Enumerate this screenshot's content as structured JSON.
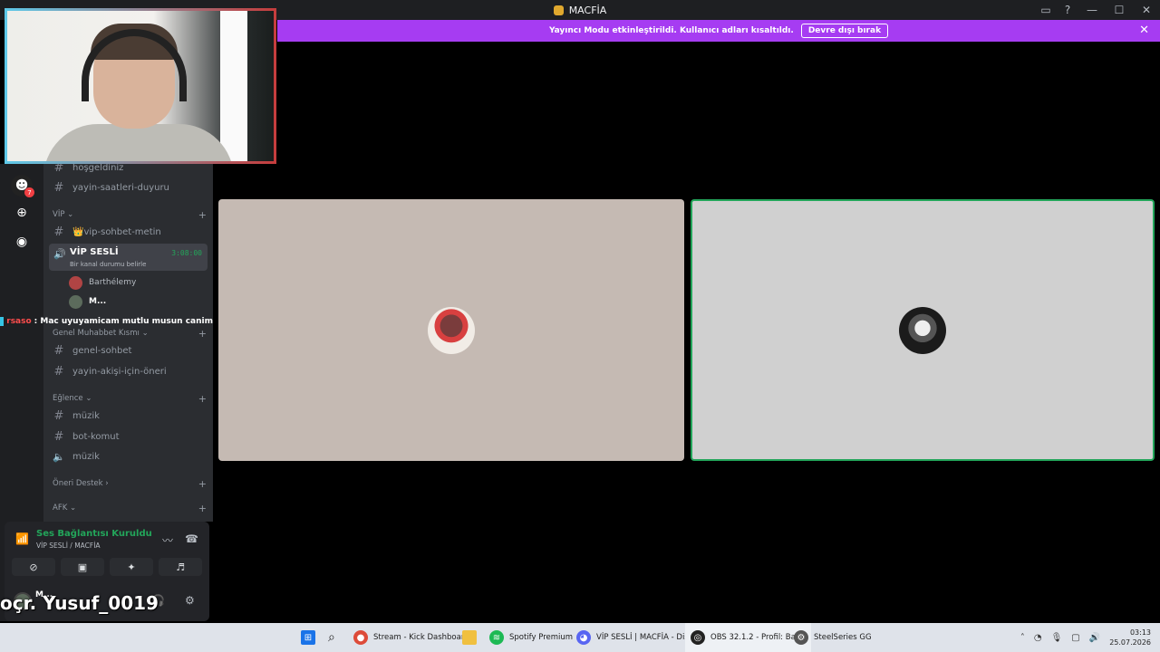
{
  "window": {
    "title": "MACFİA",
    "logo_icon": "fox-logo-icon"
  },
  "banner": {
    "message": "Yayıncı Modu etkinleştirildi. Kullanıcı adları kısaltıldı.",
    "button": "Devre dışı bırak",
    "color": "#a63cf2"
  },
  "channels": {
    "top": [
      {
        "name": "hoşgeldiniz"
      },
      {
        "name": "yayin-saatleri-duyuru"
      }
    ],
    "vip_category": "VİP",
    "vip_text": "👑vip-sohbet-metin",
    "vip_voice": {
      "name": "VİP SESLİ",
      "status": "Bir kanal durumu belirle",
      "time": "3:08:00",
      "members": [
        "Barthélemy",
        "M..."
      ]
    },
    "genel_category": "Genel Muhabbet Kısmı",
    "genel": [
      "genel-sohbet",
      "yayin-akişi-için-öneri"
    ],
    "eglence_category": "Eğlence",
    "eglence": [
      "müzik",
      "bot-komut"
    ],
    "eglence_voice": "müzik",
    "oneri_category": "Öneri Destek",
    "afk_category": "AFK"
  },
  "chat_overlay": {
    "user": "rsaso",
    "message": ": Mac uyuyamicam mutlu musun canim"
  },
  "voice_panel": {
    "title": "Ses Bağlantısı Kuruldu",
    "subtitle": "VİP SESLİ / MACFİA",
    "user_short": "M...",
    "accent": "#23a55a"
  },
  "overlay_name": "oçr. Yusuf_0019",
  "taskbar": {
    "items": [
      {
        "label": "Stream - Kick Dashboar",
        "icon": "chrome-icon"
      },
      {
        "label": "Spotify Premium",
        "icon": "spotify-icon"
      },
      {
        "label": "VİP SESLİ | MACFİA - Dis",
        "icon": "discord-icon"
      },
      {
        "label": "OBS 32.1.2 - Profil: Başlıl",
        "icon": "obs-icon"
      },
      {
        "label": "SteelSeries GG",
        "icon": "steelseries-icon"
      }
    ],
    "time": "03:13",
    "date": "25.07.2026"
  }
}
